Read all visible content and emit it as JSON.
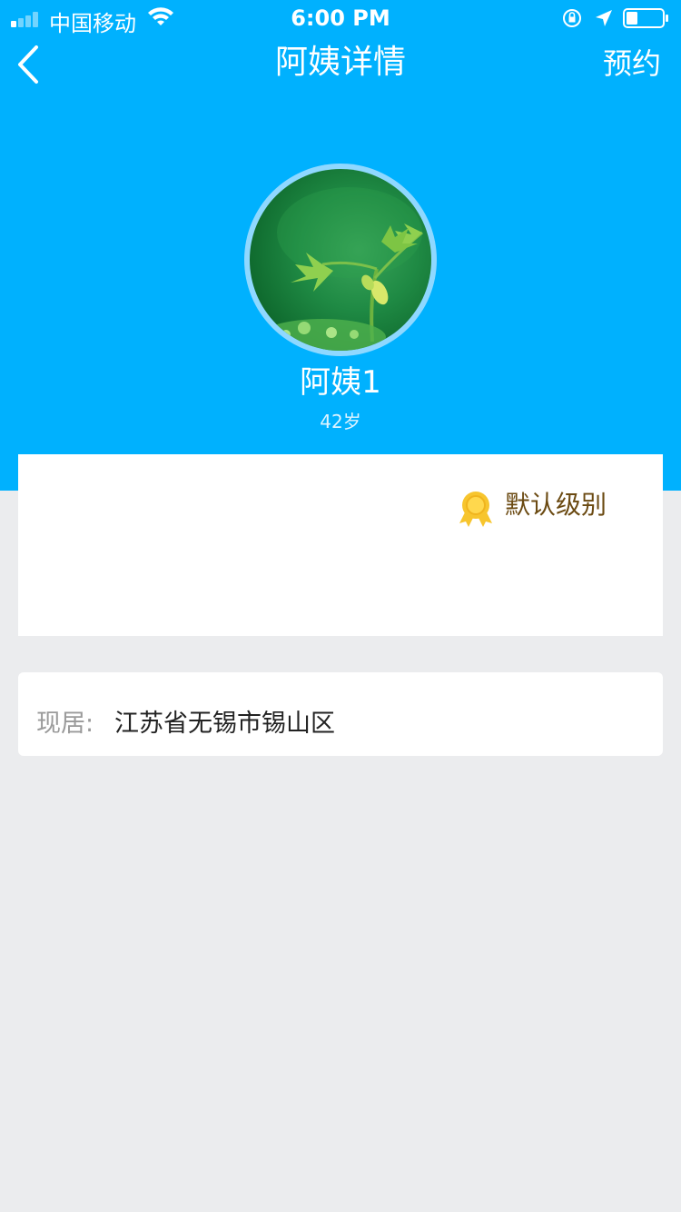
{
  "status_bar": {
    "carrier": "中国移动",
    "time": "6:00 PM"
  },
  "nav": {
    "title": "阿姨详情",
    "action_label": "预约"
  },
  "profile": {
    "name": "阿姨1",
    "age": "42岁"
  },
  "level": {
    "label": "默认级别"
  },
  "address": {
    "key": "现居:",
    "value": "江苏省无锡市锡山区"
  },
  "colors": {
    "primary": "#00b1fe",
    "background": "#ebecee",
    "level_text": "#6b4a12",
    "medal": "#f7c52e"
  }
}
